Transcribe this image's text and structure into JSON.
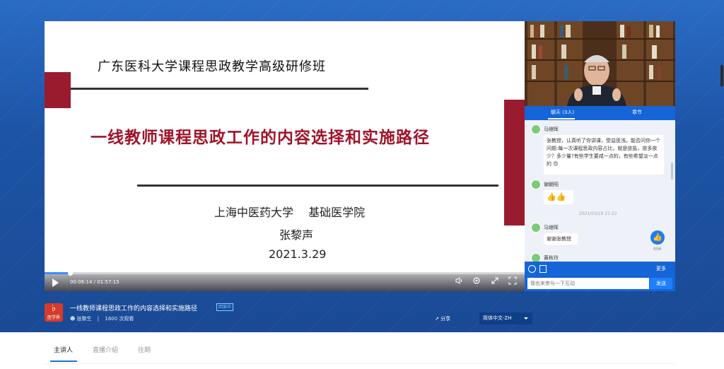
{
  "slide": {
    "header": "广东医科大学课程思政教学高级研修班",
    "title": "一线教师课程思政工作的内容选择和实施路径",
    "institution": "上海中医药大学　 基础医学院",
    "author": "张黎声",
    "date": "2021.3.29"
  },
  "player": {
    "time": "00:06:14 / 01:57:15",
    "progress_fraction": 0.053,
    "icons": [
      "play-icon",
      "volume-icon",
      "settings-icon",
      "pip-icon",
      "fullscreen-icon"
    ]
  },
  "chat": {
    "tabs": [
      "聊天 (3人)",
      "章节"
    ],
    "messages": [
      {
        "name": "马继晖",
        "text": "张教授，认真听了你讲课，受益匪浅，能否问你一个问题:每一次课程思政内容占比，就是放盐，放多放少？多少量?有些学生要咸一点的，有些希望淡一点的 😊"
      },
      {
        "name": "谢朝阳",
        "text": "👍👍"
      },
      {
        "name": "马继晖",
        "text": "谢谢张教授"
      },
      {
        "name": "黄秋玲",
        "text": ""
      }
    ],
    "timestamp": "2021/03/29 21:22",
    "like_count": "696",
    "more_label": "更多",
    "input_placeholder": "我也来参与一下互动",
    "send_label": "发送"
  },
  "info": {
    "logo_text": "医学界",
    "video_title": "一线教师课程思政工作的内容选择和实施路径",
    "replay_badge": "回放中",
    "presenter": "张黎生",
    "separator": "|",
    "views": "1600 次观看",
    "share_label": "分享",
    "language": "简体中文-ZH"
  },
  "tabs": [
    "主讲人",
    "直播介绍",
    "往期"
  ],
  "colors": {
    "accent": "#1565d8",
    "slide_red": "#9b1b2e",
    "title_red": "#a0142a"
  }
}
